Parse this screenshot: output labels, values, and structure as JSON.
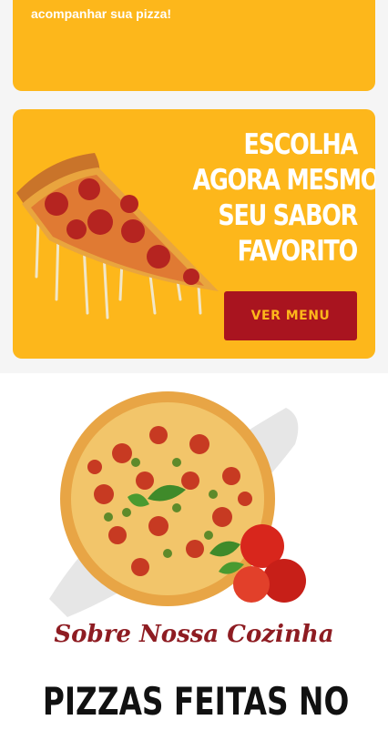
{
  "top_card": {
    "text": "acompanhar sua pizza!"
  },
  "promo": {
    "heading_lines": [
      "ESCOLHA",
      "AGORA MESMO",
      "SEU SABOR",
      "FAVORITO"
    ],
    "button_label": "VER MENU"
  },
  "about": {
    "script_title": "Sobre Nossa Cozinha",
    "heading": "PIZZAS FEITAS NO"
  },
  "colors": {
    "yellow": "#fdb71b",
    "red": "#a9141f",
    "dark_red": "#8e1c22"
  }
}
